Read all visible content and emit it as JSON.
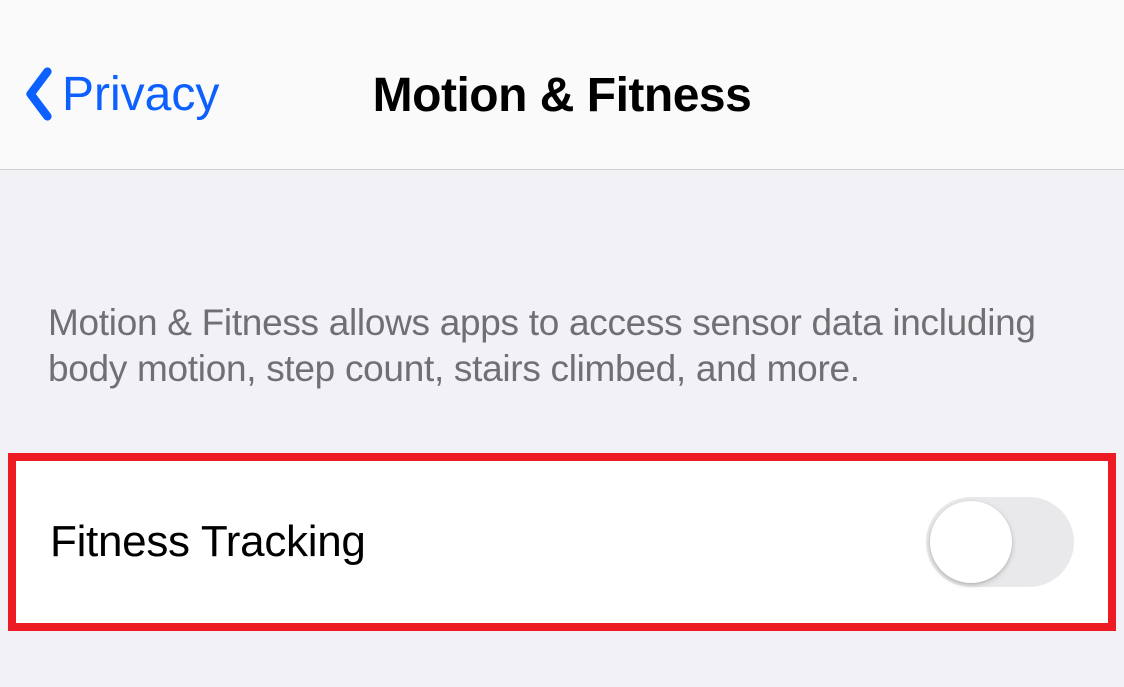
{
  "nav": {
    "back_label": "Privacy",
    "title": "Motion & Fitness"
  },
  "section": {
    "description": "Motion & Fitness allows apps to access sensor data including body motion, step count, stairs climbed, and more."
  },
  "row": {
    "label": "Fitness Tracking",
    "enabled": false
  },
  "colors": {
    "accent": "#0b60ff",
    "highlight": "#ed1c24"
  }
}
